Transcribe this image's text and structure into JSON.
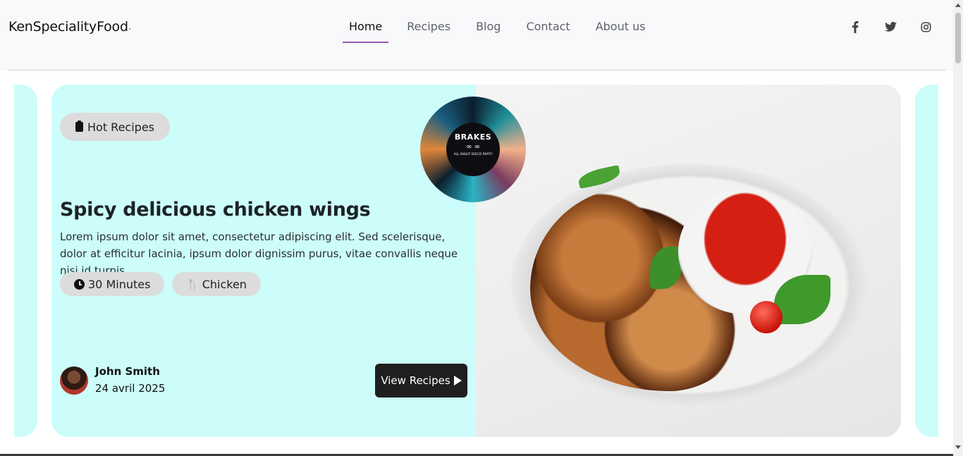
{
  "header": {
    "brand": "KenSpecialityFood",
    "nav": [
      {
        "label": "Home",
        "active": true
      },
      {
        "label": "Recipes",
        "active": false
      },
      {
        "label": "Blog",
        "active": false
      },
      {
        "label": "Contact",
        "active": false
      },
      {
        "label": "About us",
        "active": false
      }
    ],
    "socials": [
      {
        "icon": "facebook-icon",
        "glyph": "f"
      },
      {
        "icon": "twitter-icon",
        "glyph": "🐦"
      },
      {
        "icon": "instagram-icon",
        "glyph": "◎"
      }
    ]
  },
  "hero": {
    "tag": "Hot Recipes",
    "title": "Spicy delicious chicken wings",
    "description": "Lorem ipsum dolor sit amet, consectetur adipiscing elit. Sed scelerisque, dolor at efficitur lacinia, ipsum dolor dignissim purus, vitae convallis neque nisi id turpis.",
    "time": "30 Minutes",
    "category": "Chicken",
    "author": "John Smith",
    "date": "24 avril 2025",
    "cta": "View Recipes"
  },
  "badge": {
    "title": "BRAKES",
    "symbols": "∞ ∞",
    "subtitle": "ALL NIGHT DISCO PARTY"
  },
  "colors": {
    "card_bg": "#ccfdfb",
    "accent": "#9b59b6",
    "pill_bg": "#dcdcdc",
    "button_bg": "#1f1f1f"
  }
}
